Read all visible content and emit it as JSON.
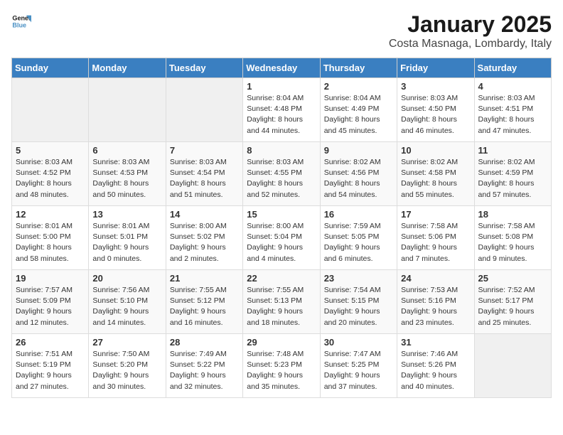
{
  "logo": {
    "line1": "General",
    "line2": "Blue"
  },
  "title": "January 2025",
  "subtitle": "Costa Masnaga, Lombardy, Italy",
  "days_of_week": [
    "Sunday",
    "Monday",
    "Tuesday",
    "Wednesday",
    "Thursday",
    "Friday",
    "Saturday"
  ],
  "weeks": [
    [
      {
        "day": "",
        "info": ""
      },
      {
        "day": "",
        "info": ""
      },
      {
        "day": "",
        "info": ""
      },
      {
        "day": "1",
        "info": "Sunrise: 8:04 AM\nSunset: 4:48 PM\nDaylight: 8 hours\nand 44 minutes."
      },
      {
        "day": "2",
        "info": "Sunrise: 8:04 AM\nSunset: 4:49 PM\nDaylight: 8 hours\nand 45 minutes."
      },
      {
        "day": "3",
        "info": "Sunrise: 8:03 AM\nSunset: 4:50 PM\nDaylight: 8 hours\nand 46 minutes."
      },
      {
        "day": "4",
        "info": "Sunrise: 8:03 AM\nSunset: 4:51 PM\nDaylight: 8 hours\nand 47 minutes."
      }
    ],
    [
      {
        "day": "5",
        "info": "Sunrise: 8:03 AM\nSunset: 4:52 PM\nDaylight: 8 hours\nand 48 minutes."
      },
      {
        "day": "6",
        "info": "Sunrise: 8:03 AM\nSunset: 4:53 PM\nDaylight: 8 hours\nand 50 minutes."
      },
      {
        "day": "7",
        "info": "Sunrise: 8:03 AM\nSunset: 4:54 PM\nDaylight: 8 hours\nand 51 minutes."
      },
      {
        "day": "8",
        "info": "Sunrise: 8:03 AM\nSunset: 4:55 PM\nDaylight: 8 hours\nand 52 minutes."
      },
      {
        "day": "9",
        "info": "Sunrise: 8:02 AM\nSunset: 4:56 PM\nDaylight: 8 hours\nand 54 minutes."
      },
      {
        "day": "10",
        "info": "Sunrise: 8:02 AM\nSunset: 4:58 PM\nDaylight: 8 hours\nand 55 minutes."
      },
      {
        "day": "11",
        "info": "Sunrise: 8:02 AM\nSunset: 4:59 PM\nDaylight: 8 hours\nand 57 minutes."
      }
    ],
    [
      {
        "day": "12",
        "info": "Sunrise: 8:01 AM\nSunset: 5:00 PM\nDaylight: 8 hours\nand 58 minutes."
      },
      {
        "day": "13",
        "info": "Sunrise: 8:01 AM\nSunset: 5:01 PM\nDaylight: 9 hours\nand 0 minutes."
      },
      {
        "day": "14",
        "info": "Sunrise: 8:00 AM\nSunset: 5:02 PM\nDaylight: 9 hours\nand 2 minutes."
      },
      {
        "day": "15",
        "info": "Sunrise: 8:00 AM\nSunset: 5:04 PM\nDaylight: 9 hours\nand 4 minutes."
      },
      {
        "day": "16",
        "info": "Sunrise: 7:59 AM\nSunset: 5:05 PM\nDaylight: 9 hours\nand 6 minutes."
      },
      {
        "day": "17",
        "info": "Sunrise: 7:58 AM\nSunset: 5:06 PM\nDaylight: 9 hours\nand 7 minutes."
      },
      {
        "day": "18",
        "info": "Sunrise: 7:58 AM\nSunset: 5:08 PM\nDaylight: 9 hours\nand 9 minutes."
      }
    ],
    [
      {
        "day": "19",
        "info": "Sunrise: 7:57 AM\nSunset: 5:09 PM\nDaylight: 9 hours\nand 12 minutes."
      },
      {
        "day": "20",
        "info": "Sunrise: 7:56 AM\nSunset: 5:10 PM\nDaylight: 9 hours\nand 14 minutes."
      },
      {
        "day": "21",
        "info": "Sunrise: 7:55 AM\nSunset: 5:12 PM\nDaylight: 9 hours\nand 16 minutes."
      },
      {
        "day": "22",
        "info": "Sunrise: 7:55 AM\nSunset: 5:13 PM\nDaylight: 9 hours\nand 18 minutes."
      },
      {
        "day": "23",
        "info": "Sunrise: 7:54 AM\nSunset: 5:15 PM\nDaylight: 9 hours\nand 20 minutes."
      },
      {
        "day": "24",
        "info": "Sunrise: 7:53 AM\nSunset: 5:16 PM\nDaylight: 9 hours\nand 23 minutes."
      },
      {
        "day": "25",
        "info": "Sunrise: 7:52 AM\nSunset: 5:17 PM\nDaylight: 9 hours\nand 25 minutes."
      }
    ],
    [
      {
        "day": "26",
        "info": "Sunrise: 7:51 AM\nSunset: 5:19 PM\nDaylight: 9 hours\nand 27 minutes."
      },
      {
        "day": "27",
        "info": "Sunrise: 7:50 AM\nSunset: 5:20 PM\nDaylight: 9 hours\nand 30 minutes."
      },
      {
        "day": "28",
        "info": "Sunrise: 7:49 AM\nSunset: 5:22 PM\nDaylight: 9 hours\nand 32 minutes."
      },
      {
        "day": "29",
        "info": "Sunrise: 7:48 AM\nSunset: 5:23 PM\nDaylight: 9 hours\nand 35 minutes."
      },
      {
        "day": "30",
        "info": "Sunrise: 7:47 AM\nSunset: 5:25 PM\nDaylight: 9 hours\nand 37 minutes."
      },
      {
        "day": "31",
        "info": "Sunrise: 7:46 AM\nSunset: 5:26 PM\nDaylight: 9 hours\nand 40 minutes."
      },
      {
        "day": "",
        "info": ""
      }
    ]
  ]
}
